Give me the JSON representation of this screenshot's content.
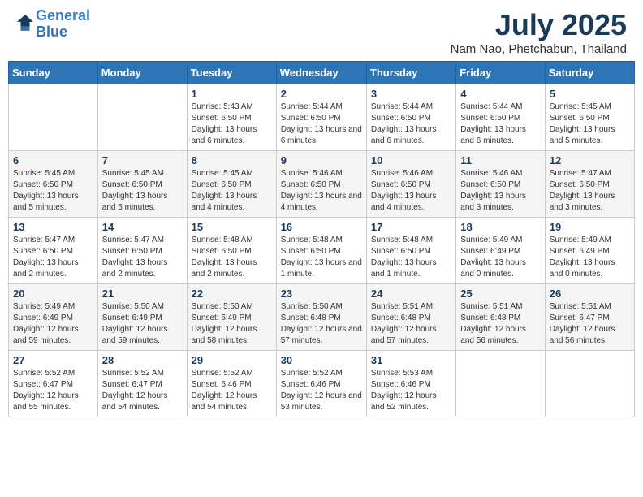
{
  "header": {
    "logo_line1": "General",
    "logo_line2": "Blue",
    "month_title": "July 2025",
    "location": "Nam Nao, Phetchabun, Thailand"
  },
  "weekdays": [
    "Sunday",
    "Monday",
    "Tuesday",
    "Wednesday",
    "Thursday",
    "Friday",
    "Saturday"
  ],
  "weeks": [
    [
      {
        "day": "",
        "info": ""
      },
      {
        "day": "",
        "info": ""
      },
      {
        "day": "1",
        "info": "Sunrise: 5:43 AM\nSunset: 6:50 PM\nDaylight: 13 hours and 6 minutes."
      },
      {
        "day": "2",
        "info": "Sunrise: 5:44 AM\nSunset: 6:50 PM\nDaylight: 13 hours and 6 minutes."
      },
      {
        "day": "3",
        "info": "Sunrise: 5:44 AM\nSunset: 6:50 PM\nDaylight: 13 hours and 6 minutes."
      },
      {
        "day": "4",
        "info": "Sunrise: 5:44 AM\nSunset: 6:50 PM\nDaylight: 13 hours and 6 minutes."
      },
      {
        "day": "5",
        "info": "Sunrise: 5:45 AM\nSunset: 6:50 PM\nDaylight: 13 hours and 5 minutes."
      }
    ],
    [
      {
        "day": "6",
        "info": "Sunrise: 5:45 AM\nSunset: 6:50 PM\nDaylight: 13 hours and 5 minutes."
      },
      {
        "day": "7",
        "info": "Sunrise: 5:45 AM\nSunset: 6:50 PM\nDaylight: 13 hours and 5 minutes."
      },
      {
        "day": "8",
        "info": "Sunrise: 5:45 AM\nSunset: 6:50 PM\nDaylight: 13 hours and 4 minutes."
      },
      {
        "day": "9",
        "info": "Sunrise: 5:46 AM\nSunset: 6:50 PM\nDaylight: 13 hours and 4 minutes."
      },
      {
        "day": "10",
        "info": "Sunrise: 5:46 AM\nSunset: 6:50 PM\nDaylight: 13 hours and 4 minutes."
      },
      {
        "day": "11",
        "info": "Sunrise: 5:46 AM\nSunset: 6:50 PM\nDaylight: 13 hours and 3 minutes."
      },
      {
        "day": "12",
        "info": "Sunrise: 5:47 AM\nSunset: 6:50 PM\nDaylight: 13 hours and 3 minutes."
      }
    ],
    [
      {
        "day": "13",
        "info": "Sunrise: 5:47 AM\nSunset: 6:50 PM\nDaylight: 13 hours and 2 minutes."
      },
      {
        "day": "14",
        "info": "Sunrise: 5:47 AM\nSunset: 6:50 PM\nDaylight: 13 hours and 2 minutes."
      },
      {
        "day": "15",
        "info": "Sunrise: 5:48 AM\nSunset: 6:50 PM\nDaylight: 13 hours and 2 minutes."
      },
      {
        "day": "16",
        "info": "Sunrise: 5:48 AM\nSunset: 6:50 PM\nDaylight: 13 hours and 1 minute."
      },
      {
        "day": "17",
        "info": "Sunrise: 5:48 AM\nSunset: 6:50 PM\nDaylight: 13 hours and 1 minute."
      },
      {
        "day": "18",
        "info": "Sunrise: 5:49 AM\nSunset: 6:49 PM\nDaylight: 13 hours and 0 minutes."
      },
      {
        "day": "19",
        "info": "Sunrise: 5:49 AM\nSunset: 6:49 PM\nDaylight: 13 hours and 0 minutes."
      }
    ],
    [
      {
        "day": "20",
        "info": "Sunrise: 5:49 AM\nSunset: 6:49 PM\nDaylight: 12 hours and 59 minutes."
      },
      {
        "day": "21",
        "info": "Sunrise: 5:50 AM\nSunset: 6:49 PM\nDaylight: 12 hours and 59 minutes."
      },
      {
        "day": "22",
        "info": "Sunrise: 5:50 AM\nSunset: 6:49 PM\nDaylight: 12 hours and 58 minutes."
      },
      {
        "day": "23",
        "info": "Sunrise: 5:50 AM\nSunset: 6:48 PM\nDaylight: 12 hours and 57 minutes."
      },
      {
        "day": "24",
        "info": "Sunrise: 5:51 AM\nSunset: 6:48 PM\nDaylight: 12 hours and 57 minutes."
      },
      {
        "day": "25",
        "info": "Sunrise: 5:51 AM\nSunset: 6:48 PM\nDaylight: 12 hours and 56 minutes."
      },
      {
        "day": "26",
        "info": "Sunrise: 5:51 AM\nSunset: 6:47 PM\nDaylight: 12 hours and 56 minutes."
      }
    ],
    [
      {
        "day": "27",
        "info": "Sunrise: 5:52 AM\nSunset: 6:47 PM\nDaylight: 12 hours and 55 minutes."
      },
      {
        "day": "28",
        "info": "Sunrise: 5:52 AM\nSunset: 6:47 PM\nDaylight: 12 hours and 54 minutes."
      },
      {
        "day": "29",
        "info": "Sunrise: 5:52 AM\nSunset: 6:46 PM\nDaylight: 12 hours and 54 minutes."
      },
      {
        "day": "30",
        "info": "Sunrise: 5:52 AM\nSunset: 6:46 PM\nDaylight: 12 hours and 53 minutes."
      },
      {
        "day": "31",
        "info": "Sunrise: 5:53 AM\nSunset: 6:46 PM\nDaylight: 12 hours and 52 minutes."
      },
      {
        "day": "",
        "info": ""
      },
      {
        "day": "",
        "info": ""
      }
    ]
  ]
}
